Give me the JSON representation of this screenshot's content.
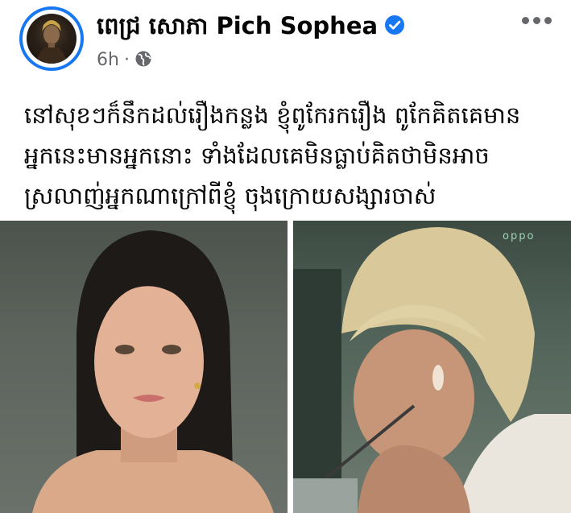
{
  "author": {
    "name": "ពេជ្រ សោភា Pich Sophea",
    "verified_icon": "verified-check-icon"
  },
  "meta": {
    "time": "6h",
    "separator": "·",
    "audience_icon": "globe-icon"
  },
  "more_icon": "more-options-icon",
  "post_text": "នៅសុខៗក៏នឹកដល់រឿងកន្លង ខ្ញុំពូកែរករឿង ពូកែគិតគេមាន\nអ្នកនេះមានអ្នកនោះ ទាំងដែលគេមិនធ្លាប់គិតថាមិនអាច\nស្រលាញ់អ្នកណាក្រៅពីខ្ញុំ ចុងក្រោយសង្សារចាស់",
  "photos": {
    "right_watermark": "oppo"
  },
  "colors": {
    "accent": "#1877f2",
    "meta_text": "#65676b"
  }
}
